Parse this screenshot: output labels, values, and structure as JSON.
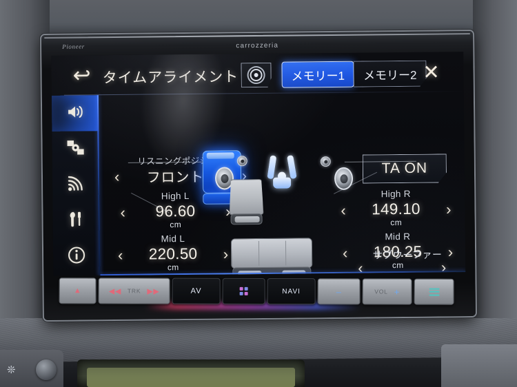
{
  "device": {
    "brand_left": "Pioneer",
    "brand_center": "carrozzeria"
  },
  "screen": {
    "header": {
      "back_label": "↩",
      "title": "タイムアライメント",
      "speaker_icon_name": "speaker-target-icon",
      "memory_tabs": [
        {
          "label": "メモリー1",
          "active": true
        },
        {
          "label": "メモリー2",
          "active": false
        }
      ],
      "close_label": "✕"
    },
    "sidebar": {
      "items": [
        {
          "name": "sound-settings",
          "icon": "speaker-icon",
          "selected": true
        },
        {
          "name": "av-source",
          "icon": "source-windows-icon",
          "selected": false
        },
        {
          "name": "connectivity",
          "icon": "wifi-signal-icon",
          "selected": false
        },
        {
          "name": "system-tools",
          "icon": "wrench-screwdriver-icon",
          "selected": false
        },
        {
          "name": "information",
          "icon": "info-circle-icon",
          "selected": false
        }
      ]
    },
    "listening_position": {
      "label": "リスニングポジション",
      "value": "フロントR",
      "prev": "‹",
      "next": "›"
    },
    "ta_button": {
      "label": "TA ON",
      "state": "ON"
    },
    "speakers": [
      {
        "key": "high_l",
        "label": "High L",
        "value": "96.60",
        "unit": "cm",
        "prev": "‹",
        "next": "›"
      },
      {
        "key": "high_r",
        "label": "High R",
        "value": "149.10",
        "unit": "cm",
        "prev": "‹",
        "next": "›"
      },
      {
        "key": "mid_l",
        "label": "Mid L",
        "value": "220.50",
        "unit": "cm",
        "prev": "‹",
        "next": "›"
      },
      {
        "key": "mid_r",
        "label": "Mid R",
        "value": "180.25",
        "unit": "cm",
        "prev": "‹",
        "next": "›"
      }
    ],
    "subwoofer": {
      "label": "サブウーファー",
      "prev": "‹",
      "next": "›"
    },
    "diagram": {
      "front_left_seat": "front-left-seat",
      "front_right_seat": "front-right-seat-selected",
      "rear_seat": "rear-bench-seat",
      "occupant": "listener-figure"
    },
    "colors": {
      "accent_blue": "#1f58e4",
      "panel_bg": "#0a0b0e",
      "text": "#f2eee6",
      "divider_blue": "#2f5ad0"
    }
  },
  "hard_buttons": [
    {
      "name": "eject-button",
      "label": "▲",
      "style": "light"
    },
    {
      "name": "track-button",
      "label": "TRK",
      "style": "light"
    },
    {
      "name": "av-button",
      "label": "AV",
      "style": "dark"
    },
    {
      "name": "apps-button",
      "label": "",
      "style": "dark"
    },
    {
      "name": "navi-button",
      "label": "NAVI",
      "style": "dark"
    },
    {
      "name": "volume-down-button",
      "label": "–",
      "style": "light"
    },
    {
      "name": "volume-label",
      "label": "VOL",
      "style": "light"
    },
    {
      "name": "volume-up-button",
      "label": "+",
      "style": "light"
    },
    {
      "name": "menu-button",
      "label": "",
      "style": "light"
    }
  ]
}
